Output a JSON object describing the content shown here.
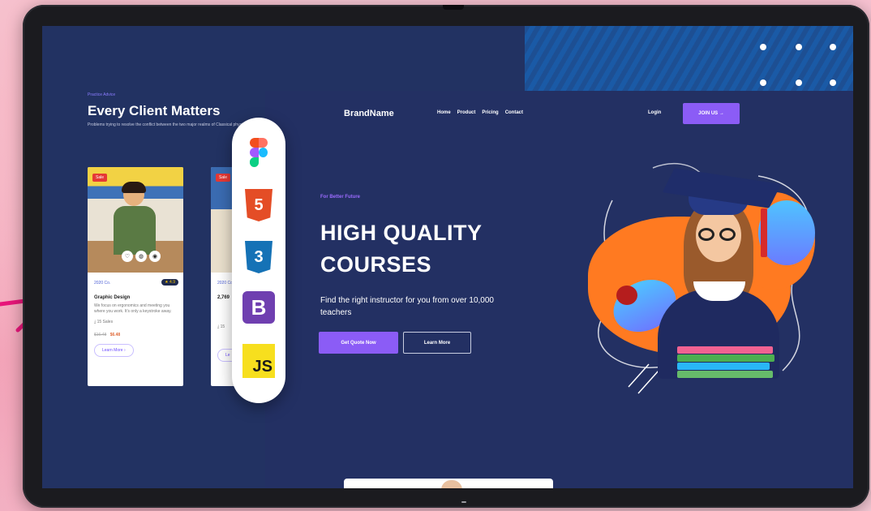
{
  "back_page": {
    "eyebrow": "Practice Advice",
    "title": "Every Client Matters",
    "description": "Problems trying to resolve the conflict between the two major realms of Classical physics: Newtonian mechanics",
    "cards": [
      {
        "sale_badge": "Sale",
        "category": "2020 Co.",
        "rating": "4.9",
        "title": "Graphic Design",
        "description": "We focus on ergonomics and meeting you where you work. It's only a keystroke away.",
        "sales": "15 Sales",
        "old_price": "$16.48",
        "new_price": "$6.48",
        "button": "Learn More"
      },
      {
        "sale_badge": "Sale",
        "category": "2020 Co.",
        "title": "2,769",
        "description": "",
        "sales": "15",
        "old_price": "",
        "new_price": "",
        "button": "Le"
      }
    ]
  },
  "front_page": {
    "brand": "BrandName",
    "nav": [
      "Home",
      "Product",
      "Pricing",
      "Contact"
    ],
    "login": "Login",
    "join_button": "JOIN US  →",
    "eyebrow": "For Better Future",
    "hero_title": "HIGH QUALITY COURSES",
    "hero_subtitle": "Find the right instructor for you from over 10,000 teachers",
    "cta_primary": "Get Quote Now",
    "cta_secondary": "Learn More"
  },
  "tool_icons": [
    "figma-icon",
    "html5-icon",
    "css3-icon",
    "bootstrap-icon",
    "javascript-icon"
  ],
  "tool_glyphs": {
    "html5": "5",
    "css3": "3",
    "bootstrap": "B",
    "javascript": "JS"
  },
  "colors": {
    "accent_purple": "#8b5cf6",
    "screen_navy": "#233063",
    "blob_orange": "#ff7a21",
    "arrow_pink": "#e8157a"
  }
}
